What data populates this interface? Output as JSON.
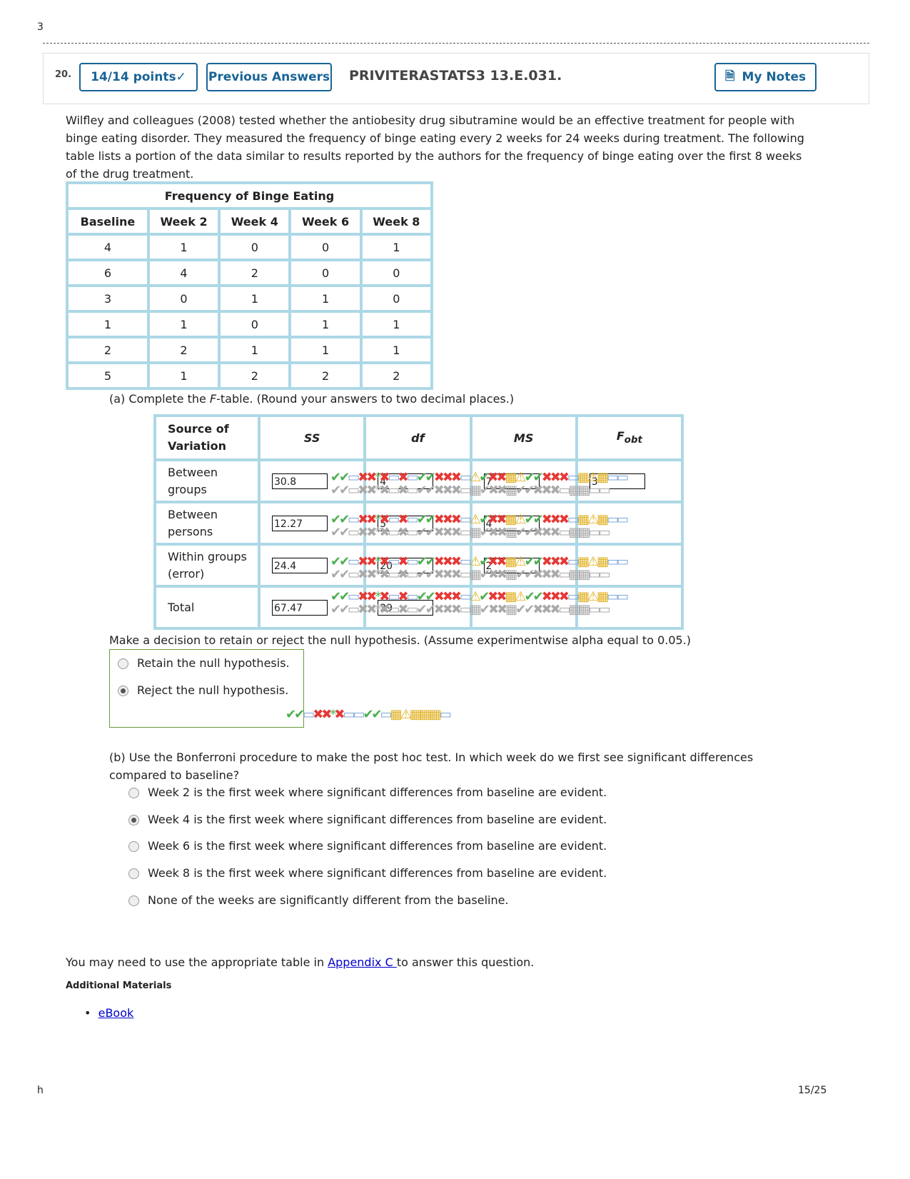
{
  "page_corner_top": "3",
  "page_corner_bottom": "h",
  "page_number": "15/25",
  "question": {
    "number": "20.",
    "points_label": "14/14 points",
    "previous_answers_label": "Previous Answers",
    "code": "PRIVITERASTATS3 13.E.031.",
    "my_notes_label": "My Notes"
  },
  "intro": "Wilfley and colleagues (2008) tested whether the antiobesity drug sibutramine would be an effective treatment for people with binge eating disorder. They measured the frequency of binge eating every 2 weeks for 24 weeks during treatment. The following table lists a portion of the data similar to results reported by the authors for the frequency of binge eating over the first 8 weeks of the drug treatment.",
  "freq_table": {
    "title": "Frequency of Binge Eating",
    "headers": [
      "Baseline",
      "Week 2",
      "Week 4",
      "Week 6",
      "Week 8"
    ],
    "rows": [
      [
        "4",
        "1",
        "0",
        "0",
        "1"
      ],
      [
        "6",
        "4",
        "2",
        "0",
        "0"
      ],
      [
        "3",
        "0",
        "1",
        "1",
        "0"
      ],
      [
        "1",
        "1",
        "0",
        "1",
        "1"
      ],
      [
        "2",
        "2",
        "1",
        "1",
        "1"
      ],
      [
        "5",
        "1",
        "2",
        "2",
        "2"
      ]
    ]
  },
  "part_a": {
    "prompt_pre": "(a) Complete the ",
    "prompt_italic": "F",
    "prompt_post": "-table. (Round your answers to two decimal places.)"
  },
  "f_table": {
    "headers": [
      "Source of Variation",
      "SS",
      "df",
      "MS",
      "F"
    ],
    "f_sub": "obt",
    "rows": [
      {
        "source": "Between groups",
        "ss": "30.8",
        "df": "4",
        "ms": "7",
        "f": "3"
      },
      {
        "source": "Between persons",
        "ss": "12.27",
        "df": "5",
        "ms": "4"
      },
      {
        "source": "Within groups (error)",
        "ss": "24.4",
        "df": "20",
        "ms": "2"
      },
      {
        "source": "Total",
        "ss": "67.47",
        "df": "29"
      }
    ]
  },
  "decision": {
    "prompt": "Make a decision to retain or reject the null hypothesis. (Assume experimentwise alpha equal to 0.05.)",
    "options": [
      {
        "label": "Retain the null hypothesis.",
        "selected": false
      },
      {
        "label": "Reject the null hypothesis.",
        "selected": true
      }
    ]
  },
  "part_b": {
    "prompt": "(b) Use the Bonferroni procedure to make the post hoc test. In which week do we first see significant differences compared to baseline?",
    "options": [
      {
        "label": "Week 2 is the first week where significant differences from baseline are evident.",
        "selected": false
      },
      {
        "label": "Week 4 is the first week where significant differences from baseline are evident.",
        "selected": true
      },
      {
        "label": "Week 6 is the first week where significant differences from baseline are evident.",
        "selected": false
      },
      {
        "label": "Week 8 is the first week where significant differences from baseline are evident.",
        "selected": false
      },
      {
        "label": "None of the weeks are significantly different from the baseline.",
        "selected": false
      }
    ]
  },
  "appendix": {
    "pre": "You may need to use the appropriate table in ",
    "link": "Appendix C ",
    "post": "to answer this question."
  },
  "additional": {
    "title": "Additional Materials",
    "links": [
      "eBook"
    ]
  },
  "colors": {
    "accent": "#1a6496",
    "table_border": "#add8e6",
    "decision_border": "#6a9a3a"
  }
}
